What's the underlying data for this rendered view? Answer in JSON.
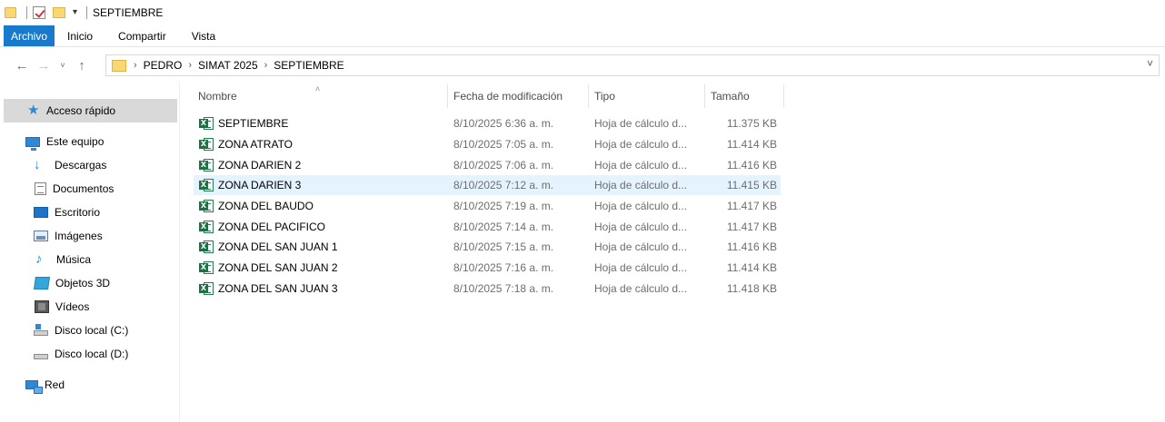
{
  "window": {
    "title": "SEPTIEMBRE",
    "quick_access_dropdown": "▾"
  },
  "ribbon": {
    "tabs": [
      {
        "label": "Archivo",
        "active": true
      },
      {
        "label": "Inicio"
      },
      {
        "label": "Compartir"
      },
      {
        "label": "Vista"
      }
    ]
  },
  "nav": {
    "back": "←",
    "forward": "→",
    "recent": "˅",
    "up": "↑"
  },
  "address": {
    "separator": "›",
    "crumbs": [
      "PEDRO",
      "SIMAT 2025",
      "SEPTIEMBRE"
    ],
    "dropdown": "˅",
    "refresh": "↻"
  },
  "navpane": {
    "items": [
      {
        "label": "Acceso rápido",
        "icon": "star-icon"
      },
      {
        "label": "Este equipo",
        "icon": "computer-icon"
      },
      {
        "label": "Descargas",
        "icon": "download-icon"
      },
      {
        "label": "Documentos",
        "icon": "document-icon"
      },
      {
        "label": "Escritorio",
        "icon": "desktop-icon"
      },
      {
        "label": "Imágenes",
        "icon": "pictures-icon"
      },
      {
        "label": "Música",
        "icon": "music-icon"
      },
      {
        "label": "Objetos 3D",
        "icon": "3d-objects-icon"
      },
      {
        "label": "Vídeos",
        "icon": "videos-icon"
      },
      {
        "label": "Disco local (C:)",
        "icon": "drive-c-icon"
      },
      {
        "label": "Disco local (D:)",
        "icon": "drive-d-icon"
      },
      {
        "label": "Red",
        "icon": "network-icon"
      }
    ]
  },
  "filelist": {
    "sort_indicator": "˄",
    "columns": {
      "name": "Nombre",
      "date": "Fecha de modificación",
      "type": "Tipo",
      "size": "Tamaño"
    },
    "excel_badge": "X",
    "rows": [
      {
        "name": "SEPTIEMBRE",
        "date": "8/10/2025 6:36 a. m.",
        "type": "Hoja de cálculo d...",
        "size": "11.375 KB"
      },
      {
        "name": "ZONA ATRATO",
        "date": "8/10/2025 7:05 a. m.",
        "type": "Hoja de cálculo d...",
        "size": "11.414 KB"
      },
      {
        "name": "ZONA DARIEN 2",
        "date": "8/10/2025 7:06 a. m.",
        "type": "Hoja de cálculo d...",
        "size": "11.416 KB"
      },
      {
        "name": "ZONA DARIEN 3",
        "date": "8/10/2025 7:12 a. m.",
        "type": "Hoja de cálculo d...",
        "size": "11.415 KB"
      },
      {
        "name": "ZONA DEL BAUDO",
        "date": "8/10/2025 7:19 a. m.",
        "type": "Hoja de cálculo d...",
        "size": "11.417 KB"
      },
      {
        "name": "ZONA DEL PACIFICO",
        "date": "8/10/2025 7:14 a. m.",
        "type": "Hoja de cálculo d...",
        "size": "11.417 KB"
      },
      {
        "name": "ZONA DEL SAN JUAN 1",
        "date": "8/10/2025 7:15 a. m.",
        "type": "Hoja de cálculo d...",
        "size": "11.416 KB"
      },
      {
        "name": "ZONA DEL SAN JUAN 2",
        "date": "8/10/2025 7:16 a. m.",
        "type": "Hoja de cálculo d...",
        "size": "11.414 KB"
      },
      {
        "name": "ZONA DEL SAN JUAN 3",
        "date": "8/10/2025 7:18 a. m.",
        "type": "Hoja de cálculo d...",
        "size": "11.418 KB"
      }
    ]
  }
}
